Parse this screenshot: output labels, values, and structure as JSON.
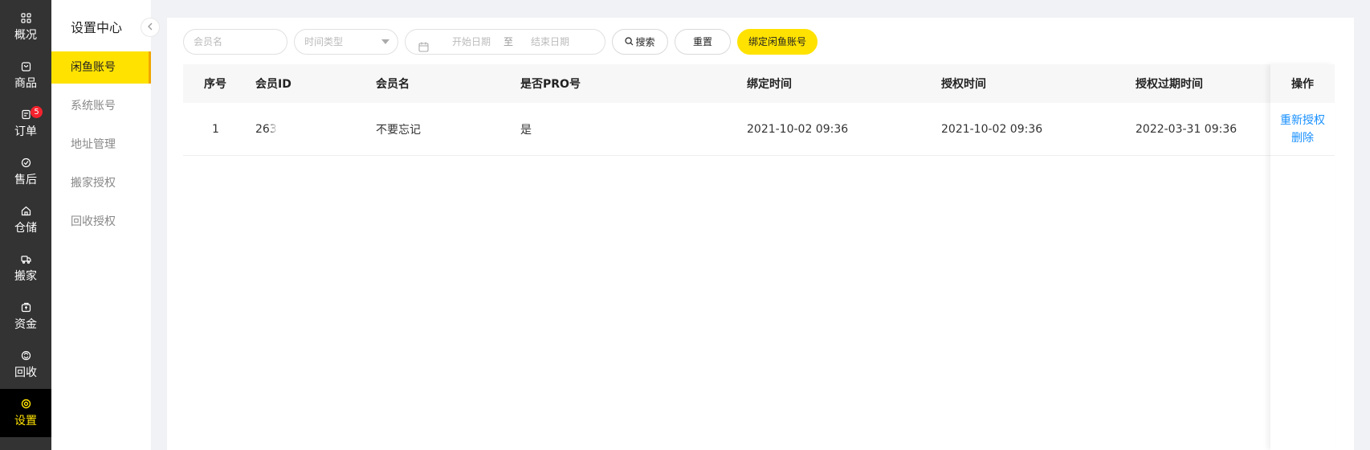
{
  "nav": {
    "items": [
      {
        "label": "概况",
        "icon": "grid-icon"
      },
      {
        "label": "商品",
        "icon": "bag-icon"
      },
      {
        "label": "订单",
        "icon": "order-icon",
        "badge": "5"
      },
      {
        "label": "售后",
        "icon": "service-icon"
      },
      {
        "label": "仓储",
        "icon": "warehouse-icon"
      },
      {
        "label": "搬家",
        "icon": "truck-icon"
      },
      {
        "label": "资金",
        "icon": "wallet-icon"
      },
      {
        "label": "回收",
        "icon": "recycle-icon"
      },
      {
        "label": "设置",
        "icon": "settings-icon",
        "active": true
      }
    ]
  },
  "subnav": {
    "title": "设置中心",
    "items": [
      {
        "label": "闲鱼账号",
        "active": true
      },
      {
        "label": "系统账号"
      },
      {
        "label": "地址管理"
      },
      {
        "label": "搬家授权"
      },
      {
        "label": "回收授权"
      }
    ]
  },
  "toolbar": {
    "member_placeholder": "会员名",
    "time_type_placeholder": "时间类型",
    "start_date_placeholder": "开始日期",
    "range_separator": "至",
    "end_date_placeholder": "结束日期",
    "search_label": "搜索",
    "reset_label": "重置",
    "bind_label": "绑定闲鱼账号"
  },
  "table": {
    "columns": [
      "序号",
      "会员ID",
      "会员名",
      "是否PRO号",
      "绑定时间",
      "授权时间",
      "授权过期时间",
      "操作"
    ],
    "rows": [
      {
        "index": "1",
        "member_id": "263",
        "member_name": "不要忘记",
        "is_pro": "是",
        "bind_time": "2021-10-02 09:36",
        "auth_time": "2021-10-02 09:36",
        "expire_time": "2022-03-31 09:36",
        "actions": [
          "重新授权",
          "删除"
        ]
      }
    ]
  },
  "colors": {
    "accent": "#ffe200",
    "nav_bg": "#333333",
    "link": "#1890ff",
    "badge": "#f5222d"
  }
}
